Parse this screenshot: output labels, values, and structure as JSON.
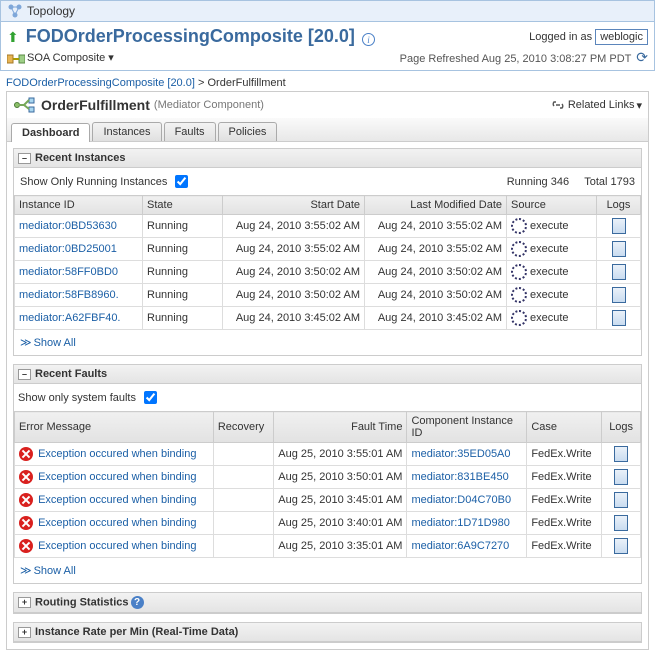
{
  "topology_label": "Topology",
  "composite_name": "FODOrderProcessingComposite [20.0]",
  "logged_in_label": "Logged in as",
  "logged_in_user": "weblogic",
  "soa_menu_label": "SOA Composite",
  "refresh_label": "Page Refreshed Aug 25, 2010 3:08:27 PM PDT",
  "breadcrumb": {
    "root": "FODOrderProcessingComposite [20.0]",
    "sep": ">",
    "current": "OrderFulfillment"
  },
  "component": {
    "name": "OrderFulfillment",
    "type": "(Mediator Component)"
  },
  "related_links_label": "Related Links",
  "tabs": [
    "Dashboard",
    "Instances",
    "Faults",
    "Policies"
  ],
  "recent_instances": {
    "title": "Recent Instances",
    "filter_label": "Show Only Running Instances",
    "filter_checked": true,
    "running_label": "Running",
    "running_count": "346",
    "total_label": "Total",
    "total_count": "1793",
    "columns": [
      "Instance ID",
      "State",
      "Start Date",
      "Last Modified Date",
      "Source",
      "Logs"
    ],
    "rows": [
      {
        "id": "mediator:0BD53630",
        "state": "Running",
        "start": "Aug 24, 2010 3:55:02 AM",
        "mod": "Aug 24, 2010 3:55:02 AM",
        "source": "execute"
      },
      {
        "id": "mediator:0BD25001",
        "state": "Running",
        "start": "Aug 24, 2010 3:55:02 AM",
        "mod": "Aug 24, 2010 3:55:02 AM",
        "source": "execute"
      },
      {
        "id": "mediator:58FF0BD0",
        "state": "Running",
        "start": "Aug 24, 2010 3:50:02 AM",
        "mod": "Aug 24, 2010 3:50:02 AM",
        "source": "execute"
      },
      {
        "id": "mediator:58FB8960.",
        "state": "Running",
        "start": "Aug 24, 2010 3:50:02 AM",
        "mod": "Aug 24, 2010 3:50:02 AM",
        "source": "execute"
      },
      {
        "id": "mediator:A62FBF40.",
        "state": "Running",
        "start": "Aug 24, 2010 3:45:02 AM",
        "mod": "Aug 24, 2010 3:45:02 AM",
        "source": "execute"
      }
    ],
    "show_all": "Show All"
  },
  "recent_faults": {
    "title": "Recent Faults",
    "filter_label": "Show only system faults",
    "filter_checked": true,
    "columns": [
      "Error Message",
      "Recovery",
      "Fault Time",
      "Component Instance ID",
      "Case",
      "Logs"
    ],
    "rows": [
      {
        "msg": "Exception occured when binding",
        "time": "Aug 25, 2010 3:55:01 AM",
        "cid": "mediator:35ED05A0",
        "case": "FedEx.Write"
      },
      {
        "msg": "Exception occured when binding",
        "time": "Aug 25, 2010 3:50:01 AM",
        "cid": "mediator:831BE450",
        "case": "FedEx.Write"
      },
      {
        "msg": "Exception occured when binding",
        "time": "Aug 25, 2010 3:45:01 AM",
        "cid": "mediator:D04C70B0",
        "case": "FedEx.Write"
      },
      {
        "msg": "Exception occured when binding",
        "time": "Aug 25, 2010 3:40:01 AM",
        "cid": "mediator:1D71D980",
        "case": "FedEx.Write"
      },
      {
        "msg": "Exception occured when binding",
        "time": "Aug 25, 2010 3:35:01 AM",
        "cid": "mediator:6A9C7270",
        "case": "FedEx.Write"
      }
    ],
    "show_all": "Show All"
  },
  "routing_section": "Routing Statistics",
  "rate_section": "Instance Rate per Min (Real-Time Data)"
}
